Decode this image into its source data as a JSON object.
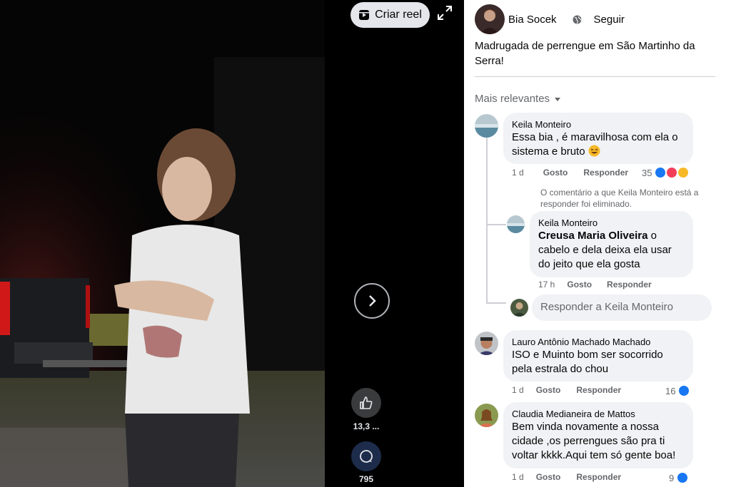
{
  "video": {
    "create_reel_label": "Criar reel",
    "likes_count": "13,3 ...",
    "comments_count": "795"
  },
  "post": {
    "author": "Bia Socek",
    "follow_label": "Seguir",
    "caption": "Madrugada de perrengue em São Martinho da Serra!",
    "sort_label": "Mais relevantes"
  },
  "comments": [
    {
      "name": "Keila Monteiro",
      "text_line1": "Essa bia , é maravilhosa com ela o",
      "text_line2": "sistema e bruto",
      "time": "1 d",
      "like": "Gosto",
      "reply": "Responder",
      "reactions": "35",
      "deleted_note": "O comentário a que Keila Monteiro está a responder foi eliminado.",
      "replies": [
        {
          "name": "Keila Monteiro",
          "mention": "Creusa Maria Oliveira",
          "text_after_mention": " o",
          "text_line2": "cabelo e dela deixa ela usar",
          "text_line3": "do jeito que ela gosta",
          "time": "17 h",
          "like": "Gosto",
          "reply": "Responder"
        }
      ],
      "reply_placeholder": "Responder a Keila Monteiro"
    },
    {
      "name": "Lauro Antônio Machado Machado",
      "text_line1": "ISO e Muinto bom ser socorrido",
      "text_line2": "pela estrala do chou",
      "time": "1 d",
      "like": "Gosto",
      "reply": "Responder",
      "reactions": "16"
    },
    {
      "name": "Claudia Medianeira de Mattos",
      "text_line1": "Bem vinda novamente a nossa",
      "text_line2": "cidade ,os perrengues são pra ti",
      "text_line3": "voltar kkkk.Aqui tem só gente boa!",
      "time": "1 d",
      "like": "Gosto",
      "reply": "Responder",
      "reactions": "9"
    }
  ],
  "colors": {
    "like_blue": "#1877f2",
    "love_red": "#f33e58",
    "haha_yellow": "#f7b928",
    "panel_bg": "#ffffff",
    "bubble_bg": "#f0f2f5"
  }
}
